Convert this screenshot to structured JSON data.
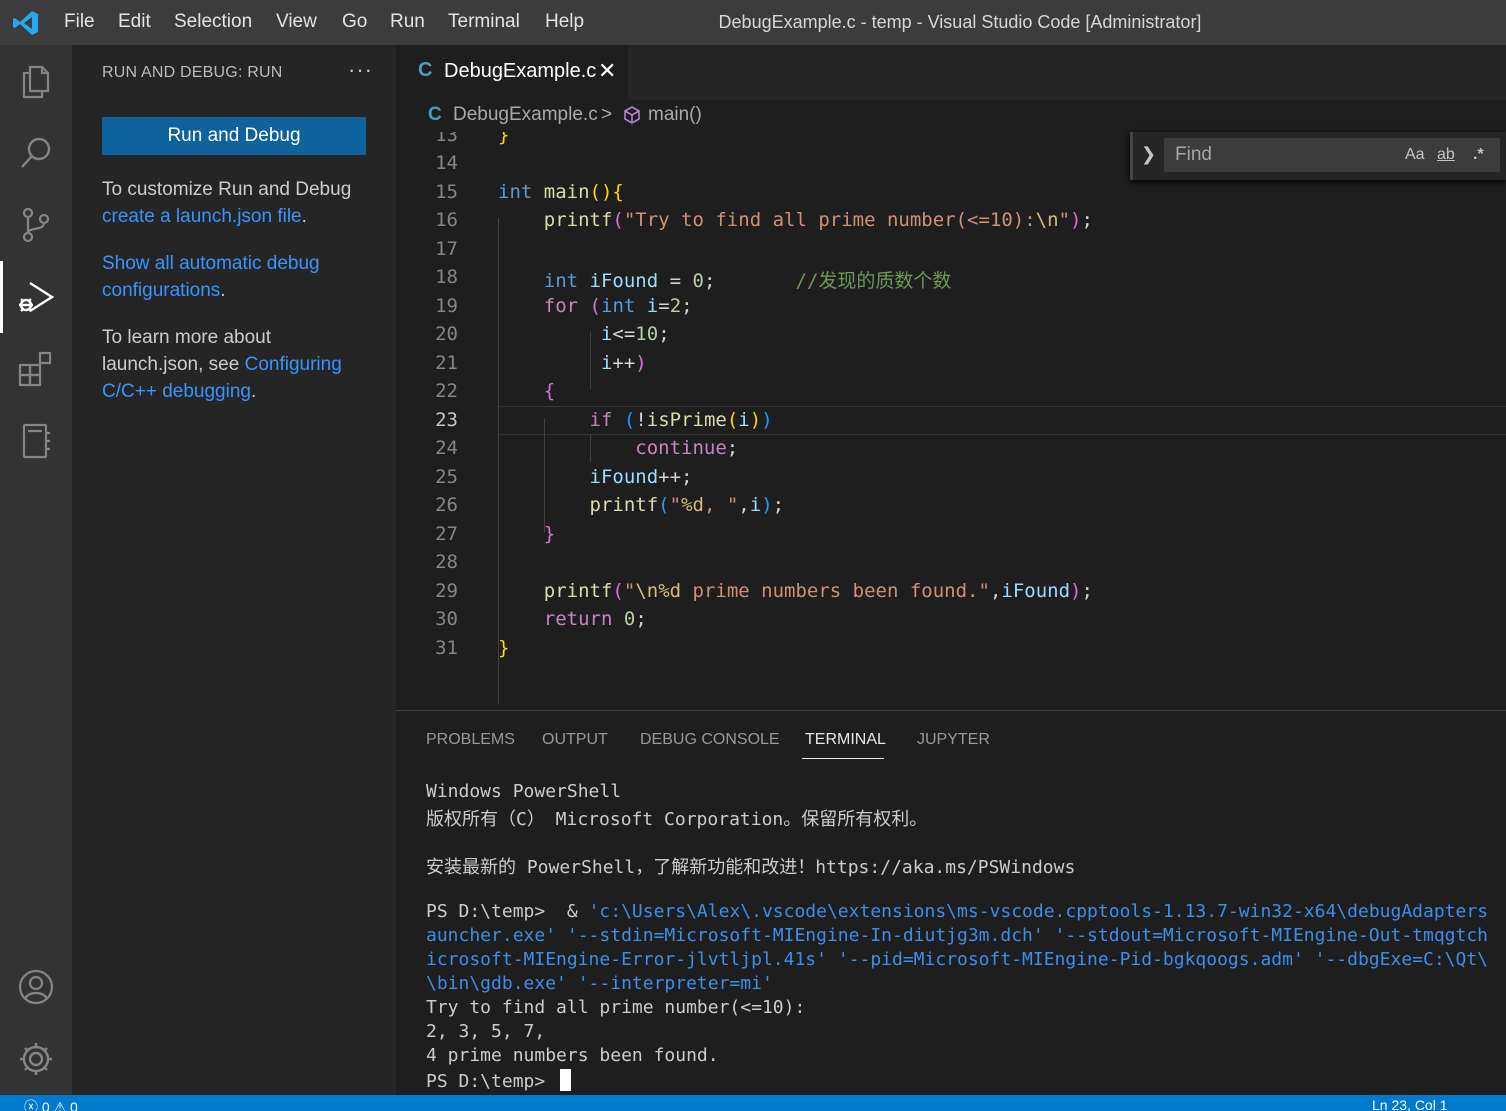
{
  "titlebar": {
    "menu": [
      "File",
      "Edit",
      "Selection",
      "View",
      "Go",
      "Run",
      "Terminal",
      "Help"
    ],
    "title": "DebugExample.c - temp - Visual Studio Code [Administrator]"
  },
  "activitybar": {
    "icons": [
      "explorer-icon",
      "search-icon",
      "source-control-icon",
      "run-debug-icon",
      "extensions-icon",
      "notebook-icon",
      "account-icon",
      "settings-gear-icon"
    ]
  },
  "sidebar": {
    "title": "RUN AND DEBUG: RUN",
    "more": "···",
    "run_button": "Run and Debug",
    "customize_text": "To customize Run and Debug",
    "create_link": "create a launch.json file",
    "period1": ".",
    "show_link": "Show all automatic debug configurations",
    "period2": ".",
    "learn_text": "To learn more about launch.json, see ",
    "configuring_link": "Configuring C/C++ debugging",
    "period3": "."
  },
  "tabs": {
    "icon_letter": "C",
    "active_label": "DebugExample.c",
    "close": "✕"
  },
  "breadcrumb": {
    "file_icon": "C",
    "file": "DebugExample.c",
    "separator": ">",
    "symbol": "main()"
  },
  "find": {
    "placeholder": "Find",
    "match_case": "Aa",
    "whole_word": "ab",
    "regex": ".*"
  },
  "editor": {
    "current_line": 23,
    "line_numbers": [
      13,
      14,
      15,
      16,
      17,
      18,
      19,
      20,
      21,
      22,
      23,
      24,
      25,
      26,
      27,
      28,
      29,
      30,
      31
    ],
    "comment_line_18": "//发现的质数个数"
  },
  "panel": {
    "tabs": [
      "PROBLEMS",
      "OUTPUT",
      "DEBUG CONSOLE",
      "TERMINAL",
      "JUPYTER"
    ],
    "active_tab": "TERMINAL",
    "terminal": {
      "l1": "Windows PowerShell",
      "l2": "版权所有（C） Microsoft Corporation。保留所有权利。",
      "l3": "安装最新的 PowerShell，了解新功能和改进！https://aka.ms/PSWindows",
      "l4_prompt": "PS D:\\temp>  & ",
      "l4_link": "'c:\\Users\\Alex\\.vscode\\extensions\\ms-vscode.cpptools-1.13.7-win32-x64\\debugAdapters",
      "l5": "auncher.exe' '--stdin=Microsoft-MIEngine-In-diutjg3m.dch' '--stdout=Microsoft-MIEngine-Out-tmqgtch",
      "l6": "icrosoft-MIEngine-Error-jlvtljpl.41s' '--pid=Microsoft-MIEngine-Pid-bgkqoogs.adm' '--dbgExe=C:\\Qt\\",
      "l7": "\\bin\\gdb.exe' '--interpreter=mi'",
      "l8": "Try to find all prime number(<=10):",
      "l9": "2, 3, 5, 7,",
      "l10": "4 prime numbers been found.",
      "l11": "PS D:\\temp> "
    }
  },
  "statusbar": {
    "problems": "ⓧ 0 ⚠ 0",
    "position": "Ln 23, Col 1"
  },
  "colors": {
    "accent": "#007acc",
    "button": "#0e639c",
    "link": "#3794ff"
  }
}
